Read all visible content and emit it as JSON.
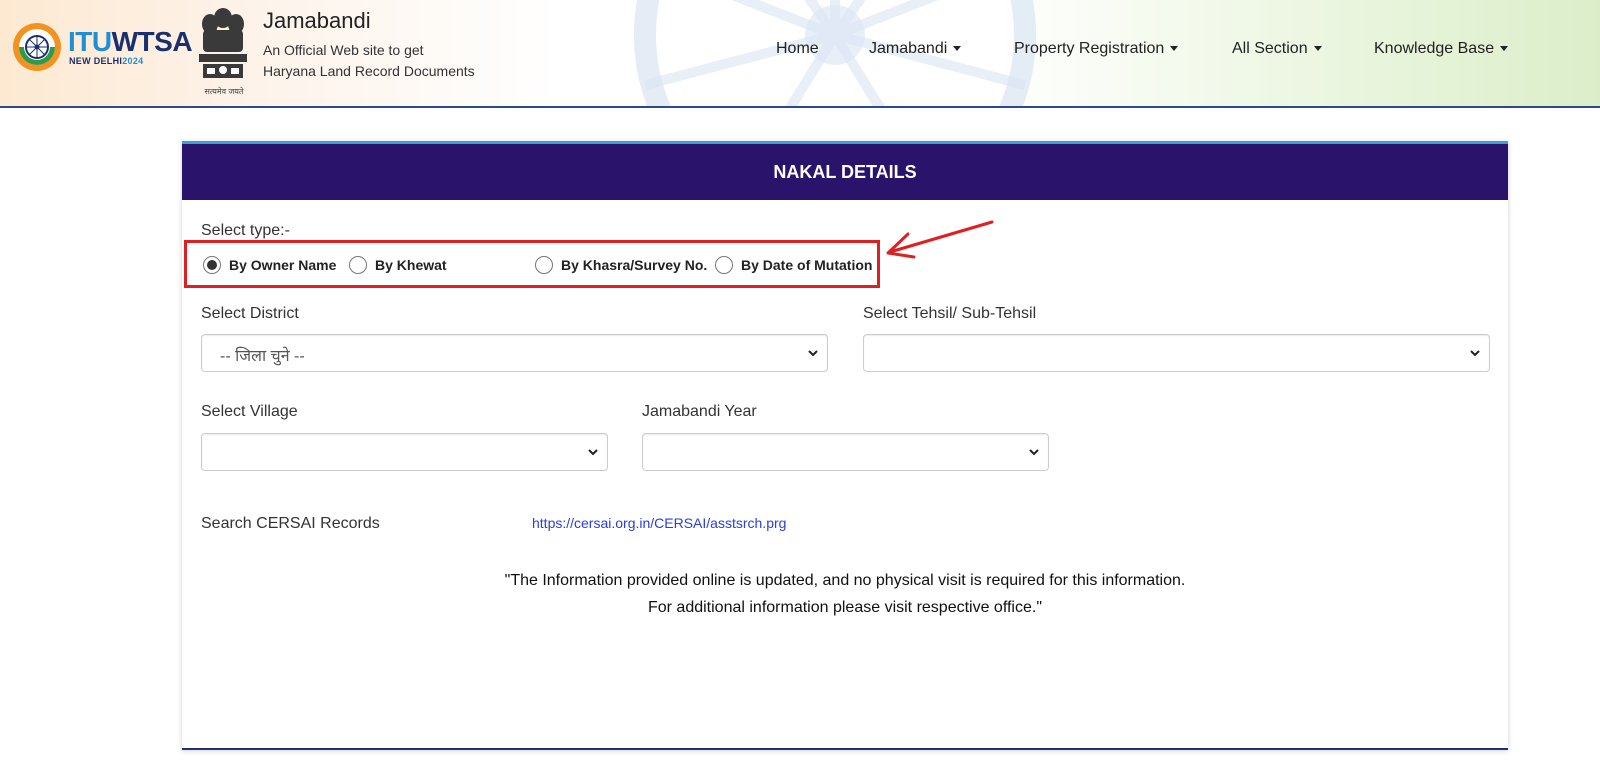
{
  "header": {
    "partner_logo": {
      "line1_a": "ITU",
      "line1_b": "WTSA",
      "line2_a": "NEW DELHI",
      "line2_b": "2024"
    },
    "emblem_caption": "सत्यमेव जयते",
    "title": "Jamabandi",
    "subtitle_line1": "An Official Web site to get",
    "subtitle_line2": "Haryana Land Record Documents"
  },
  "nav": {
    "items": [
      {
        "label": "Home",
        "has_dropdown": false
      },
      {
        "label": "Jamabandi",
        "has_dropdown": true
      },
      {
        "label": "Property Registration",
        "has_dropdown": true
      },
      {
        "label": "All Section",
        "has_dropdown": true
      },
      {
        "label": "Knowledge Base",
        "has_dropdown": true
      }
    ]
  },
  "card": {
    "title": "NAKAL DETAILS",
    "select_type_label": "Select type:-",
    "radio_options": [
      {
        "label": "By Owner Name",
        "checked": true
      },
      {
        "label": "By Khewat",
        "checked": false
      },
      {
        "label": "By Khasra/Survey No.",
        "checked": false
      },
      {
        "label": "By Date of Mutation",
        "checked": false
      }
    ],
    "district": {
      "label": "Select District",
      "value": "-- जिला चुने --"
    },
    "tehsil": {
      "label": "Select Tehsil/ Sub-Tehsil",
      "value": ""
    },
    "village": {
      "label": "Select Village",
      "value": ""
    },
    "year": {
      "label": "Jamabandi Year",
      "value": ""
    },
    "cersai_label": "Search CERSAI Records",
    "cersai_link": "https://cersai.org.in/CERSAI/asstsrch.prg",
    "note_line1": "\"The Information provided online is updated, and no physical visit is required for this information.",
    "note_line2": "For additional information please visit respective office.\""
  },
  "colors": {
    "card_header_bg": "#2a136b",
    "annotation_red": "#e02020",
    "link_blue": "#2b3de0",
    "header_border": "#2e4a8a"
  }
}
